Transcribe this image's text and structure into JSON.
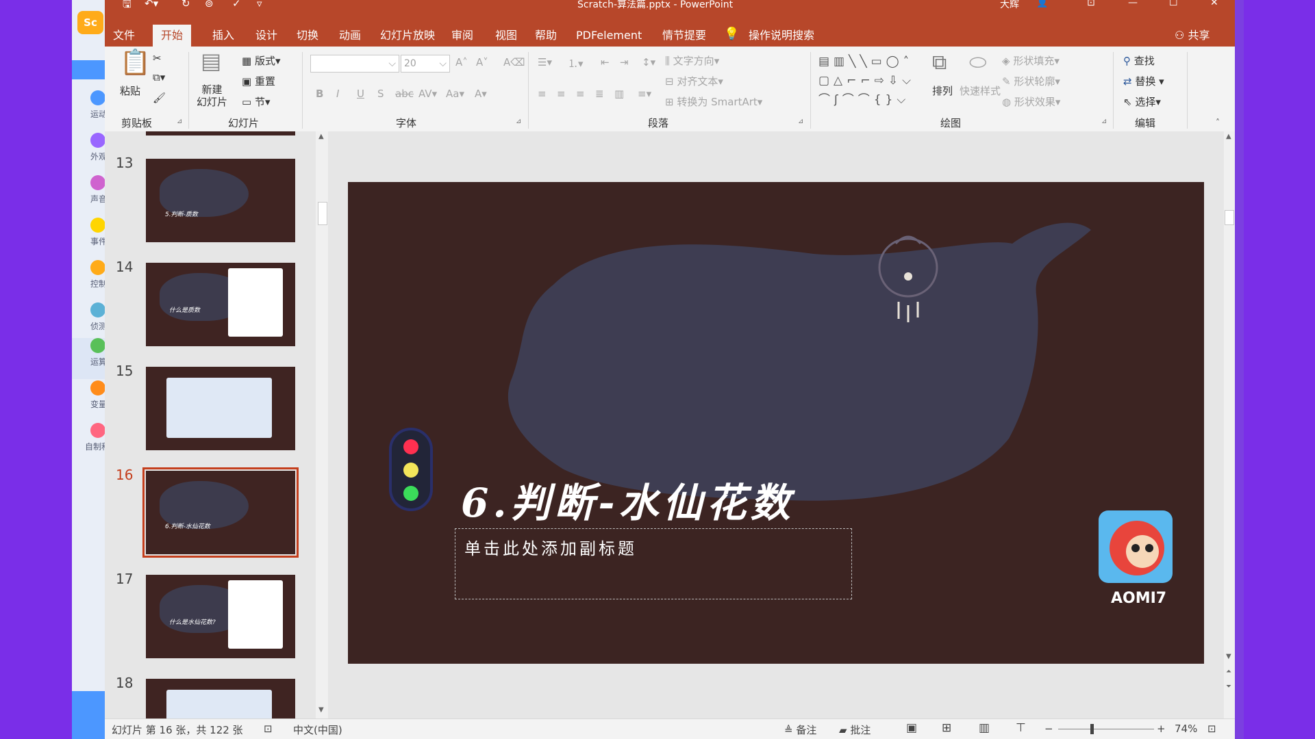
{
  "window": {
    "title": "Scratch-算法篇.pptx - PowerPoint",
    "user": "大辉"
  },
  "menu": {
    "tabs": [
      "文件",
      "开始",
      "插入",
      "设计",
      "切换",
      "动画",
      "幻灯片放映",
      "审阅",
      "视图",
      "帮助",
      "PDFelement",
      "情节提要"
    ],
    "active": "开始",
    "search": "操作说明搜索",
    "share": "共享"
  },
  "ribbon": {
    "clipboard": {
      "label": "剪贴板",
      "paste": "粘贴"
    },
    "slides": {
      "label": "幻灯片",
      "new_slide": "新建\n幻灯片",
      "layout": "版式",
      "reset": "重置",
      "section": "节"
    },
    "font": {
      "label": "字体",
      "size": "20"
    },
    "paragraph": {
      "label": "段落",
      "text_direction": "文字方向",
      "align_text": "对齐文本",
      "smartart": "转换为 SmartArt"
    },
    "drawing": {
      "label": "绘图",
      "arrange": "排列",
      "quick_styles": "快速样式",
      "fill": "形状填充",
      "outline": "形状轮廓",
      "effects": "形状效果"
    },
    "editing": {
      "label": "编辑",
      "find": "查找",
      "replace": "替换",
      "select": "选择"
    }
  },
  "scratch_sidebar": {
    "categories": [
      {
        "label": "运动",
        "color": "#4c97ff"
      },
      {
        "label": "外观",
        "color": "#9966ff"
      },
      {
        "label": "声音",
        "color": "#cf63cf"
      },
      {
        "label": "事件",
        "color": "#ffd500"
      },
      {
        "label": "控制",
        "color": "#ffab19"
      },
      {
        "label": "侦测",
        "color": "#5cb1d6"
      },
      {
        "label": "运算",
        "color": "#59c059"
      },
      {
        "label": "变量",
        "color": "#ff8c1a"
      },
      {
        "label": "自制积木",
        "color": "#ff6680"
      }
    ]
  },
  "thumbnails": [
    {
      "num": "13",
      "caption": "5.判断-质数"
    },
    {
      "num": "14",
      "caption": "什么是质数"
    },
    {
      "num": "15",
      "caption": ""
    },
    {
      "num": "16",
      "caption": "6.判断-水仙花数"
    },
    {
      "num": "17",
      "caption": "什么是水仙花数?"
    },
    {
      "num": "18",
      "caption": ""
    }
  ],
  "slide": {
    "title": "6.判断-水仙花数",
    "subtitle_placeholder": "单击此处添加副标题",
    "logo_text": "AOMI7",
    "colors": {
      "background": "#3c2422",
      "blob": "#3f3e52"
    }
  },
  "status": {
    "slide_info": "幻灯片 第 16 张，共 122 张",
    "language": "中文(中国)",
    "notes": "备注",
    "comments": "批注",
    "zoom": "74%"
  },
  "colors": {
    "accent": "#b7472a",
    "selection": "#c43e1c"
  }
}
